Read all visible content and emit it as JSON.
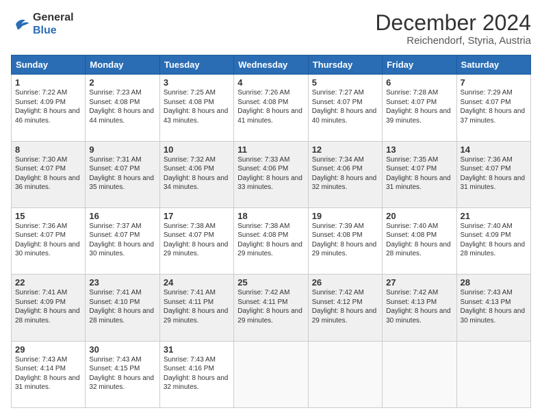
{
  "logo": {
    "line1": "General",
    "line2": "Blue"
  },
  "title": "December 2024",
  "location": "Reichendorf, Styria, Austria",
  "days_header": [
    "Sunday",
    "Monday",
    "Tuesday",
    "Wednesday",
    "Thursday",
    "Friday",
    "Saturday"
  ],
  "weeks": [
    [
      {
        "day": "1",
        "sunrise": "7:22 AM",
        "sunset": "4:09 PM",
        "daylight": "8 hours and 46 minutes."
      },
      {
        "day": "2",
        "sunrise": "7:23 AM",
        "sunset": "4:08 PM",
        "daylight": "8 hours and 44 minutes."
      },
      {
        "day": "3",
        "sunrise": "7:25 AM",
        "sunset": "4:08 PM",
        "daylight": "8 hours and 43 minutes."
      },
      {
        "day": "4",
        "sunrise": "7:26 AM",
        "sunset": "4:08 PM",
        "daylight": "8 hours and 41 minutes."
      },
      {
        "day": "5",
        "sunrise": "7:27 AM",
        "sunset": "4:07 PM",
        "daylight": "8 hours and 40 minutes."
      },
      {
        "day": "6",
        "sunrise": "7:28 AM",
        "sunset": "4:07 PM",
        "daylight": "8 hours and 39 minutes."
      },
      {
        "day": "7",
        "sunrise": "7:29 AM",
        "sunset": "4:07 PM",
        "daylight": "8 hours and 37 minutes."
      }
    ],
    [
      {
        "day": "8",
        "sunrise": "7:30 AM",
        "sunset": "4:07 PM",
        "daylight": "8 hours and 36 minutes."
      },
      {
        "day": "9",
        "sunrise": "7:31 AM",
        "sunset": "4:07 PM",
        "daylight": "8 hours and 35 minutes."
      },
      {
        "day": "10",
        "sunrise": "7:32 AM",
        "sunset": "4:06 PM",
        "daylight": "8 hours and 34 minutes."
      },
      {
        "day": "11",
        "sunrise": "7:33 AM",
        "sunset": "4:06 PM",
        "daylight": "8 hours and 33 minutes."
      },
      {
        "day": "12",
        "sunrise": "7:34 AM",
        "sunset": "4:06 PM",
        "daylight": "8 hours and 32 minutes."
      },
      {
        "day": "13",
        "sunrise": "7:35 AM",
        "sunset": "4:07 PM",
        "daylight": "8 hours and 31 minutes."
      },
      {
        "day": "14",
        "sunrise": "7:36 AM",
        "sunset": "4:07 PM",
        "daylight": "8 hours and 31 minutes."
      }
    ],
    [
      {
        "day": "15",
        "sunrise": "7:36 AM",
        "sunset": "4:07 PM",
        "daylight": "8 hours and 30 minutes."
      },
      {
        "day": "16",
        "sunrise": "7:37 AM",
        "sunset": "4:07 PM",
        "daylight": "8 hours and 30 minutes."
      },
      {
        "day": "17",
        "sunrise": "7:38 AM",
        "sunset": "4:07 PM",
        "daylight": "8 hours and 29 minutes."
      },
      {
        "day": "18",
        "sunrise": "7:38 AM",
        "sunset": "4:08 PM",
        "daylight": "8 hours and 29 minutes."
      },
      {
        "day": "19",
        "sunrise": "7:39 AM",
        "sunset": "4:08 PM",
        "daylight": "8 hours and 29 minutes."
      },
      {
        "day": "20",
        "sunrise": "7:40 AM",
        "sunset": "4:08 PM",
        "daylight": "8 hours and 28 minutes."
      },
      {
        "day": "21",
        "sunrise": "7:40 AM",
        "sunset": "4:09 PM",
        "daylight": "8 hours and 28 minutes."
      }
    ],
    [
      {
        "day": "22",
        "sunrise": "7:41 AM",
        "sunset": "4:09 PM",
        "daylight": "8 hours and 28 minutes."
      },
      {
        "day": "23",
        "sunrise": "7:41 AM",
        "sunset": "4:10 PM",
        "daylight": "8 hours and 28 minutes."
      },
      {
        "day": "24",
        "sunrise": "7:41 AM",
        "sunset": "4:11 PM",
        "daylight": "8 hours and 29 minutes."
      },
      {
        "day": "25",
        "sunrise": "7:42 AM",
        "sunset": "4:11 PM",
        "daylight": "8 hours and 29 minutes."
      },
      {
        "day": "26",
        "sunrise": "7:42 AM",
        "sunset": "4:12 PM",
        "daylight": "8 hours and 29 minutes."
      },
      {
        "day": "27",
        "sunrise": "7:42 AM",
        "sunset": "4:13 PM",
        "daylight": "8 hours and 30 minutes."
      },
      {
        "day": "28",
        "sunrise": "7:43 AM",
        "sunset": "4:13 PM",
        "daylight": "8 hours and 30 minutes."
      }
    ],
    [
      {
        "day": "29",
        "sunrise": "7:43 AM",
        "sunset": "4:14 PM",
        "daylight": "8 hours and 31 minutes."
      },
      {
        "day": "30",
        "sunrise": "7:43 AM",
        "sunset": "4:15 PM",
        "daylight": "8 hours and 32 minutes."
      },
      {
        "day": "31",
        "sunrise": "7:43 AM",
        "sunset": "4:16 PM",
        "daylight": "8 hours and 32 minutes."
      },
      null,
      null,
      null,
      null
    ]
  ]
}
